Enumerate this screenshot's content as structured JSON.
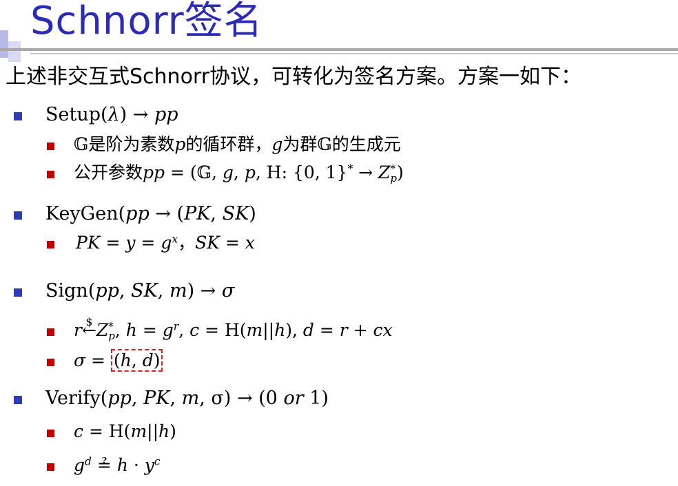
{
  "slide": {
    "title": "Schnorr签名",
    "intro": "上述非交互式Schnorr协议，可转化为签名方案。方案一如下："
  },
  "setup": {
    "head": {
      "fn": "Setup",
      "lambda": "λ",
      "arrow": " → ",
      "out": "pp"
    },
    "line1": {
      "group": "𝔾",
      "t1": "是阶为素数",
      "p": "p",
      "t2": "的循环群，",
      "g": "g",
      "t3": "为群",
      "group2": "𝔾",
      "t4": "的生成元"
    },
    "line2": {
      "t1": "公开参数",
      "pp": "pp",
      "eq": " = (",
      "group": "𝔾",
      "c1": ", ",
      "g": "g",
      "c2": ", ",
      "p": "p",
      "c3": ", ",
      "hash": "H",
      "colon": ": {0, 1}",
      "star": "*",
      "arrow": " → ",
      "z": "Z",
      "zsup": "*",
      "zsub": "p",
      "close": ")"
    }
  },
  "keygen": {
    "head": {
      "fn": "KeyGen",
      "in": "pp",
      "arrow": " → (",
      "pk": "PK",
      "comma": ", ",
      "sk": "SK",
      "close": ")"
    },
    "line1": {
      "pk": "PK",
      "eq1": " = ",
      "y": "y",
      "eq2": " = ",
      "g": "g",
      "x": "x",
      "sep": "，",
      "sk": "SK",
      "eq3": " = ",
      "x2": "x"
    }
  },
  "sign": {
    "head": {
      "fn": "Sign",
      "pp": "pp",
      "c1": ", ",
      "sk": "SK",
      "c2": ", ",
      "m": "m",
      "arrow": ") → ",
      "sigma": "σ"
    },
    "line1": {
      "r": "r",
      "dollar": "$",
      "larrow": "←",
      "z": "Z",
      "zsup": "*",
      "zsub": "p",
      "c1": ", ",
      "h": "h",
      "eq1": " = ",
      "g": "g",
      "rsup": "r",
      "c2": ", ",
      "c": "c",
      "eq2": " = ",
      "hash": "H",
      "m": "m",
      "bars": "||",
      "h2": "h",
      "c3": "), ",
      "d": "d",
      "eq3": " = ",
      "r2": "r",
      "plus": " + ",
      "cx": "cx"
    },
    "line2": {
      "sigma": "σ",
      "eq": " = ",
      "h": "h",
      "comma": ", ",
      "d": "d"
    }
  },
  "verify": {
    "head": {
      "fn": "Verify",
      "pp": "pp",
      "c1": ", ",
      "pk": "PK",
      "c2": ", ",
      "m": "m",
      "c3": ", ",
      "sigma": "σ",
      "arrow": ") → (0 ",
      "or": "or",
      "one": " 1)"
    },
    "line1": {
      "c": "c",
      "eq": " = ",
      "hash": "H",
      "m": "m",
      "bars": "||",
      "h": "h"
    },
    "line2": {
      "g": "g",
      "d": "d",
      "q": "?",
      "eq": "=",
      "h": "h",
      "dot": " · ",
      "y": "y",
      "c": "c"
    }
  }
}
